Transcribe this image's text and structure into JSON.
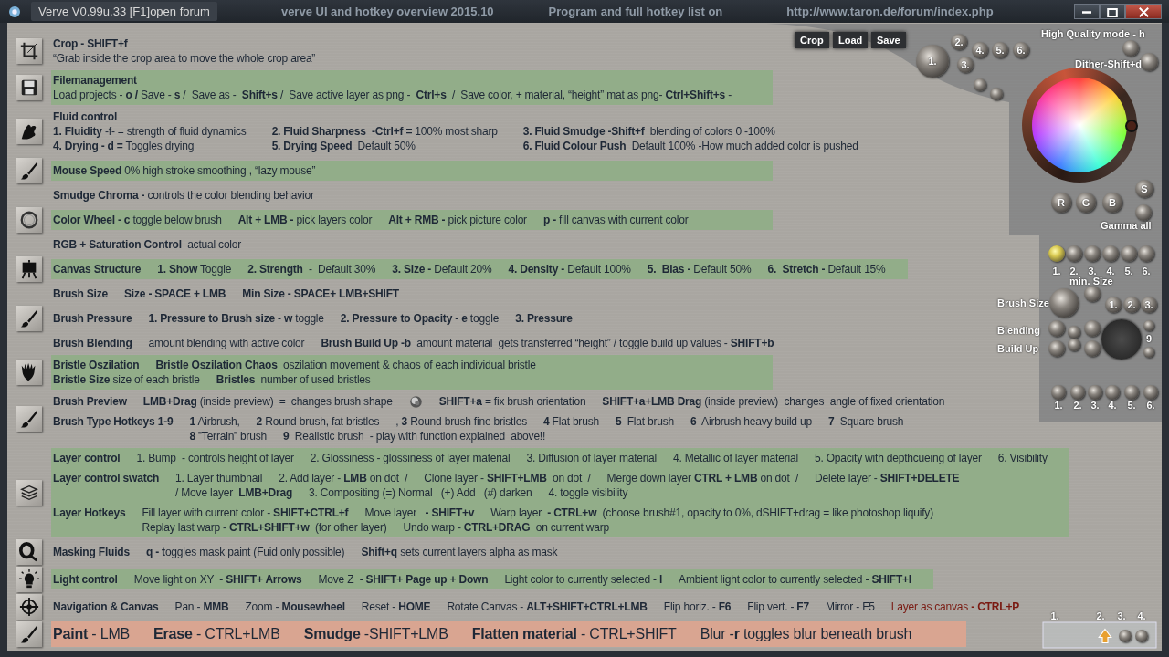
{
  "window": {
    "title": "Verve V0.99u.33 [F1]open forum",
    "captions": [
      "verve UI and hotkey overview 2015.10",
      "Program  and full hotkey list on",
      "http://www.taron.de/forum/index.php"
    ]
  },
  "groups": [
    {
      "kind": "crop",
      "entries": [
        {
          "heading": "Crop - SHIFT+f",
          "lines": [
            [
              "“Grab inside the crop area to move the whole crop area”"
            ]
          ]
        }
      ]
    },
    {
      "kind": "save",
      "color": "#92ad89",
      "entries": [
        {
          "heading": "Filemanagement",
          "lines": [
            [
              "Load projects - **o /** Save - **s** /  Save as -  **Shift+s** /  Save active layer as png -  **Ctrl+s**  /  Save color, + material, “height” mat as png- **Ctrl+Shift+s** -"
            ]
          ]
        }
      ]
    },
    {
      "kind": "fluid",
      "entries": [
        {
          "heading": "Fluid control",
          "lines": [
            [
              "**1. Fluidity** -f- = strength of fluid dynamics",
              "**2. Fluid Sharpness  -Ctrl+f =** 100% most sharp",
              "**3. Fluid Smudge -Shift+f**  blending of colors 0 -100%"
            ],
            [
              "**4. Drying - d =** Toggles drying",
              "**5. Drying Speed**  Default 50%",
              "**6. Fluid Colour Push**  Default 100% -How much added color is pushed"
            ]
          ]
        }
      ]
    },
    {
      "kind": "brush",
      "color": "#92ad89",
      "entries": [
        {
          "lines": [
            [
              "**Mouse Speed** 0% high stroke smoothing , “lazy mouse”"
            ]
          ]
        }
      ]
    },
    {
      "entries": [
        {
          "lines": [
            [
              "**Smudge Chroma -** controls the color blending behavior"
            ]
          ]
        }
      ]
    },
    {
      "kind": "wheel",
      "color": "#92ad89",
      "entries": [
        {
          "lines": [
            [
              "**Color Wheel - c** toggle below brush",
              "**Alt + LMB -** pick layers color",
              "**Alt + RMB -** pick picture color",
              "**p -** fill canvas with current color"
            ]
          ]
        }
      ]
    },
    {
      "entries": [
        {
          "lines": [
            [
              "**RGB + Saturation Control**  actual color"
            ]
          ]
        }
      ]
    },
    {
      "kind": "easel",
      "color": "#92ad89",
      "entries": [
        {
          "lines": [
            [
              {
                "text": "Canvas Structure",
                "kind": "label"
              },
              "**1. Show** Toggle",
              "**2. Strength**  -  Default 30%",
              "**3. Size -** Default 20%",
              "**4. Density -** Default 100%",
              "**5.  Bias -** Default 50%",
              "**6.  Stretch -** Default 15%"
            ]
          ]
        }
      ]
    },
    {
      "entries": [
        {
          "lines": [
            [
              {
                "text": "Brush Size",
                "kind": "label"
              },
              {
                "text": "Size - SPACE + LMB",
                "kind": "label"
              },
              {
                "text": "Min Size - SPACE+ LMB+SHIFT",
                "kind": "label"
              }
            ]
          ]
        }
      ]
    },
    {
      "kind": "brush",
      "entries": [
        {
          "lines": [
            [
              {
                "text": "Brush Pressure",
                "kind": "label"
              },
              "**1. Pressure to Brush size - w** toggle",
              "**2. Pressure to Opacity - e** toggle",
              {
                "text": "3. Pressure",
                "kind": "label"
              }
            ]
          ]
        }
      ]
    },
    {
      "entries": [
        {
          "lines": [
            [
              {
                "text": "Brush Blending",
                "kind": "label"
              },
              "amount blending with active color",
              "**Brush Build Up -b**  amount material  gets transferred “height” / toggle build up values - **SHIFT+b**"
            ]
          ]
        }
      ]
    },
    {
      "kind": "bristle",
      "color": "#92ad89",
      "entries": [
        {
          "lines": [
            [
              {
                "text": "Bristle Oszilation",
                "kind": "label"
              },
              "**Bristle Oszilation Chaos**  oszilation movement & chaos of each individual bristle"
            ],
            [
              "**Bristle Size** size of each bristle",
              "**Bristles**  number of used bristles"
            ]
          ]
        }
      ]
    },
    {
      "kind": "brush",
      "entries": [
        {
          "lines": [
            [
              {
                "text": "Brush Preview",
                "kind": "label"
              },
              "**LMB+Drag** (inside preview)  =  changes brush shape",
              {
                "kind": "icon"
              },
              "**SHIFT+a** = fix brush orientation",
              "**SHIFT+a+LMB Drag** (inside preview)  changes  angle of fixed orientation"
            ]
          ]
        },
        {
          "label": "Brush Type Hotkeys 1-9",
          "lines": [
            [
              "**1** Airbrush,",
              "**2** Round brush, fat bristles",
              ", **3** Round brush fine bristles",
              "**4** Flat brush",
              "**5**  Flat brush",
              "**6**  Airbrush heavy build up",
              "**7**  Square brush"
            ],
            [
              "**8** ”Terrain” brush",
              "**9**  Realistic brush  - play with function explained  above!!"
            ]
          ]
        }
      ]
    },
    {
      "kind": "layers",
      "color": "#92ad89",
      "entries": [
        {
          "lines": [
            [
              {
                "text": "Layer control",
                "kind": "label"
              },
              "1. Bump  - controls height of layer",
              "2. Glossiness - glossiness of layer material",
              "3. Diffusion of layer material",
              "4. Metallic of layer material",
              "5. Opacity with depthcueing of layer",
              "6. Visibility"
            ]
          ]
        },
        {
          "label": "Layer control swatch",
          "lines": [
            [
              "1. Layer thumbnail",
              "2. Add layer - **LMB** on dot  /",
              "Clone layer - **SHIFT+LMB**  on dot  /",
              "Merge down layer **CTRL + LMB** on dot  /",
              "Delete layer - **SHIFT+DELETE**"
            ],
            [
              "/ Move layer  **LMB+Drag**",
              "3. Compositing (=) Normal   (+) Add   (#) darken",
              "4. toggle visibility"
            ]
          ]
        },
        {
          "label": "Layer Hotkeys",
          "lines": [
            [
              "Fill layer with current color - **SHIFT+CTRL+f**",
              "Move layer   **- SHIFT+v**",
              "Warp layer  **- CTRL+w**  (choose brush#1, opacity to 0%, dSHIFT+drag = like photoshop liquify)"
            ],
            [
              "Replay last warp - **CTRL+SHIFT+w**  (for other layer)",
              "Undo warp - **CTRL+DRAG**  on current warp"
            ]
          ]
        }
      ]
    },
    {
      "kind": "mask",
      "entries": [
        {
          "lines": [
            [
              {
                "text": "Masking Fluids",
                "kind": "label"
              },
              "**q - t**oggles mask paint (Fuid only possible)",
              "**Shift+q** sets current layers alpha as mask"
            ]
          ]
        }
      ]
    },
    {
      "kind": "light",
      "color": "#92ad89",
      "entries": [
        {
          "lines": [
            [
              {
                "text": "Light control",
                "kind": "label"
              },
              "Move light on XY  **- SHIFT+ Arrows**",
              "Move Z  **- SHIFT+ Page up + Down**",
              "Light color to currently selected **- l**",
              "Ambient light color to currently selected **- SHIFT+l**"
            ]
          ]
        }
      ]
    },
    {
      "kind": "navigation",
      "entries": [
        {
          "lines": [
            [
              {
                "text": "Navigation & Canvas",
                "kind": "label"
              },
              "Pan - **MMB**",
              "Zoom - **Mousewheel**",
              "Reset - **HOME**",
              "Rotate Canvas - **ALT+SHIFT+CTRL+LMB**",
              "Flip horiz. - **F6**",
              "Flip vert. - **F7**",
              "Mirror - F5",
              {
                "text": "Layer as canvas **- CTRL+P**",
                "color": "#7a1a12"
              }
            ]
          ]
        }
      ]
    },
    {
      "kind": "brush",
      "color": "#d9a591",
      "entries": [
        {
          "lines": [
            [
              "**Paint** - LMB",
              "**Erase** - CTRL+LMB",
              "**Smudge** -SHIFT+LMB",
              "**Flatten material** - CTRL+SHIFT",
              "Blur -**r** toggles blur beneath brush"
            ]
          ]
        }
      ]
    }
  ],
  "panel": {
    "file_buttons": [
      "Crop",
      "Load",
      "Save"
    ],
    "presets": [
      "1.",
      "2.",
      "3.",
      "4.",
      "5.",
      "6."
    ],
    "quality_label": "High Quality mode - h",
    "dither_label": "Dither-Shift+d",
    "channel_knobs": [
      "R",
      "G",
      "B",
      "S"
    ],
    "gamma_label": "Gamma all",
    "size_slots": [
      {
        "label": "1.",
        "selected": true
      },
      {
        "label": "2.",
        "selected": false
      },
      {
        "label": "3.",
        "selected": false
      },
      {
        "label": "4.",
        "selected": false
      },
      {
        "label": "5.",
        "selected": false
      },
      {
        "label": "6.",
        "selected": false
      }
    ],
    "min_size_label": "min. Size",
    "brush_size_label": "Brush Size",
    "brush_modes": [
      "1.",
      "2.",
      "3."
    ],
    "blending_label": "Blending",
    "build_up_label": "Build Up",
    "dial_label": "9",
    "type_slots": [
      "1.",
      "2.",
      "3.",
      "4.",
      "5.",
      "6."
    ],
    "view_slots": [
      "1.",
      "2.",
      "3.",
      "4."
    ]
  }
}
